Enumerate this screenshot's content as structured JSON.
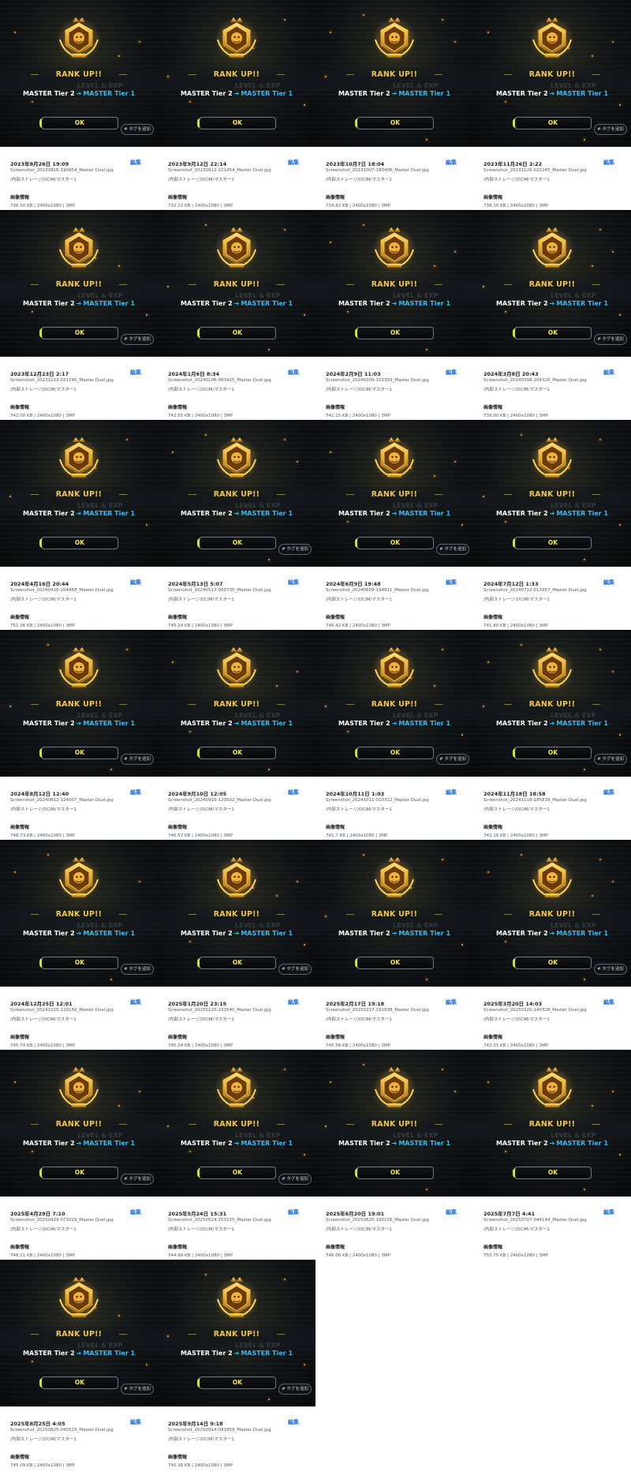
{
  "labels": {
    "rank_up": "RANK UP!!",
    "tier_from": "MASTER Tier 2",
    "tier_arrow": "➔",
    "tier_to": "MASTER Tier 1",
    "ok": "OK",
    "tag_button": "# タグを追加",
    "edit": "編集",
    "image_info": "画像情報",
    "bg_text": "LEVEL & EXP"
  },
  "colors": {
    "rank_up_text": "#f1c44a",
    "tier_highlight": "#3ab8f0",
    "ok_text": "#f3e44a",
    "edit_link": "#1f6fe0",
    "background_dark": "#07090b"
  },
  "items": [
    {
      "date": "2023年8月26日 19:09",
      "filename": "Screenshot_20230826-190954_Master Duel.jpg",
      "path": "/内部ストレージ/DCIM/マスター1",
      "size": "736.50 KB | 2400x1080 | 3MP",
      "tag_button": true
    },
    {
      "date": "2023年9月12日 22:14",
      "filename": "Screenshot_20230912-221454_Master Duel.jpg",
      "path": "/内部ストレージ/DCIM/マスター1",
      "size": "732.22 KB | 2400x1080 | 3MP",
      "tag_button": false
    },
    {
      "date": "2023年10月7日 18:04",
      "filename": "Screenshot_20231007-180406_Master Duel.jpg",
      "path": "/内部ストレージ/DCIM/マスター1",
      "size": "734.82 KB | 2400x1080 | 3MP",
      "tag_button": false
    },
    {
      "date": "2023年11月26日 2:22",
      "filename": "Screenshot_20231126-022245_Master Duel.jpg",
      "path": "/内部ストレージ/DCIM/マスター1",
      "size": "738.10 KB | 2400x1080 | 3MP",
      "tag_button": true
    },
    {
      "date": "2023年12月23日 2:17",
      "filename": "Screenshot_20231223-021745_Master Duel.jpg",
      "path": "/内部ストレージ/DCIM/マスター1",
      "size": "742.00 KB | 2400x1080 | 3MP",
      "tag_button": true
    },
    {
      "date": "2024年1月6日 8:34",
      "filename": "Screenshot_20240106-083425_Master Duel.jpg",
      "path": "/内部ストレージ/DCIM/マスター1",
      "size": "742.55 KB | 2400x1080 | 3MP",
      "tag_button": false
    },
    {
      "date": "2024年2月9日 11:03",
      "filename": "Screenshot_20240209-110359_Master Duel.jpg",
      "path": "/内部ストレージ/DCIM/マスター1",
      "size": "741.15 KB | 2400x1080 | 3MP",
      "tag_button": false
    },
    {
      "date": "2024年3月8日 20:43",
      "filename": "Screenshot_20240308-204326_Master Duel.jpg",
      "path": "/内部ストレージ/DCIM/マスター1",
      "size": "739.90 KB | 2400x1080 | 3MP",
      "tag_button": true
    },
    {
      "date": "2024年4月16日 20:44",
      "filename": "Screenshot_20240416-204458_Master Duel.jpg",
      "path": "/内部ストレージ/DCIM/マスター1",
      "size": "751.06 KB | 2400x1080 | 3MP",
      "tag_button": false
    },
    {
      "date": "2024年5月13日 5:07",
      "filename": "Screenshot_20240513-050730_Master Duel.jpg",
      "path": "/内部ストレージ/DCIM/マスター1",
      "size": "745.24 KB | 2400x1080 | 3MP",
      "tag_button": true
    },
    {
      "date": "2024年6月9日 19:48",
      "filename": "Screenshot_20240609-194811_Master Duel.jpg",
      "path": "/内部ストレージ/DCIM/マスター1",
      "size": "746.42 KB | 2400x1080 | 3MP",
      "tag_button": true
    },
    {
      "date": "2024年7月12日 1:33",
      "filename": "Screenshot_20240712-013357_Master Duel.jpg",
      "path": "/内部ストレージ/DCIM/マスター1",
      "size": "741.80 KB | 2400x1080 | 3MP",
      "tag_button": false
    },
    {
      "date": "2024年8月12日 12:40",
      "filename": "Screenshot_20240812-124007_Master Duel.jpg",
      "path": "/内部ストレージ/DCIM/マスター1",
      "size": "748.73 KB | 2400x1080 | 3MP",
      "tag_button": true
    },
    {
      "date": "2024年9月10日 12:05",
      "filename": "Screenshot_20240910-120502_Master Duel.jpg",
      "path": "/内部ストレージ/DCIM/マスター1",
      "size": "746.57 KB | 2400x1080 | 3MP",
      "tag_button": false
    },
    {
      "date": "2024年10月11日 1:03",
      "filename": "Screenshot_20241011-010312_Master Duel.jpg",
      "path": "/内部ストレージ/DCIM/マスター1",
      "size": "741.7 KB | 2400x1080 | 3MP",
      "tag_button": true
    },
    {
      "date": "2024年11月18日 18:58",
      "filename": "Screenshot_20241118-185839_Master Duel.jpg",
      "path": "/内部ストレージ/DCIM/マスター1",
      "size": "742.16 KB | 2400x1080 | 3MP",
      "tag_button": true
    },
    {
      "date": "2024年12月25日 12:01",
      "filename": "Screenshot_20241225-120156_Master Duel.jpg",
      "path": "/内部ストレージ/DCIM/マスター1",
      "size": "745.74 KB | 2400x1080 | 3MP",
      "tag_button": true
    },
    {
      "date": "2025年1月20日 23:15",
      "filename": "Screenshot_20250120-231540_Master Duel.jpg",
      "path": "/内部ストレージ/DCIM/マスター1",
      "size": "745.34 KB | 2400x1080 | 3MP",
      "tag_button": true
    },
    {
      "date": "2025年2月17日 19:18",
      "filename": "Screenshot_20250217-191838_Master Duel.jpg",
      "path": "/内部ストレージ/DCIM/マスター1",
      "size": "745.56 KB | 2400x1080 | 3MP",
      "tag_button": false
    },
    {
      "date": "2025年3月20日 14:03",
      "filename": "Screenshot_20250320-140328_Master Duel.jpg",
      "path": "/内部ストレージ/DCIM/マスター1",
      "size": "743.35 KB | 2400x1080 | 3MP",
      "tag_button": true
    },
    {
      "date": "2025年4月29日 7:10",
      "filename": "Screenshot_20250429-071029_Master Duel.jpg",
      "path": "/内部ストレージ/DCIM/マスター1",
      "size": "748.11 KB | 2400x1080 | 3MP",
      "tag_button": true
    },
    {
      "date": "2025年5月24日 15:31",
      "filename": "Screenshot_20250524-153155_Master Duel.jpg",
      "path": "/内部ストレージ/DCIM/マスター1",
      "size": "744.99 KB | 2400x1080 | 3MP",
      "tag_button": true
    },
    {
      "date": "2025年6月20日 19:01",
      "filename": "Screenshot_20250620-190156_Master Duel.jpg",
      "path": "/内部ストレージ/DCIM/マスター1",
      "size": "746.06 KB | 2400x1080 | 3MP",
      "tag_button": false
    },
    {
      "date": "2025年7月7日 4:41",
      "filename": "Screenshot_20250707-044144_Master Duel.jpg",
      "path": "/内部ストレージ/DCIM/マスター1",
      "size": "750.75 KB | 2400x1080 | 3MP",
      "tag_button": false
    },
    {
      "date": "2025年8月25日 4:05",
      "filename": "Screenshot_20250825-040529_Master Duel.jpg",
      "path": "/内部ストレージ/DCIM/マスター1",
      "size": "745.09 KB | 2400x1080 | 3MP",
      "tag_button": true
    },
    {
      "date": "2025年9月14日 9:18",
      "filename": "Screenshot_20250914-091859_Master Duel.jpg",
      "path": "/内部ストレージ/DCIM/マスター1",
      "size": "740.36 KB | 2400x1080 | 3MP",
      "tag_button": true
    }
  ]
}
